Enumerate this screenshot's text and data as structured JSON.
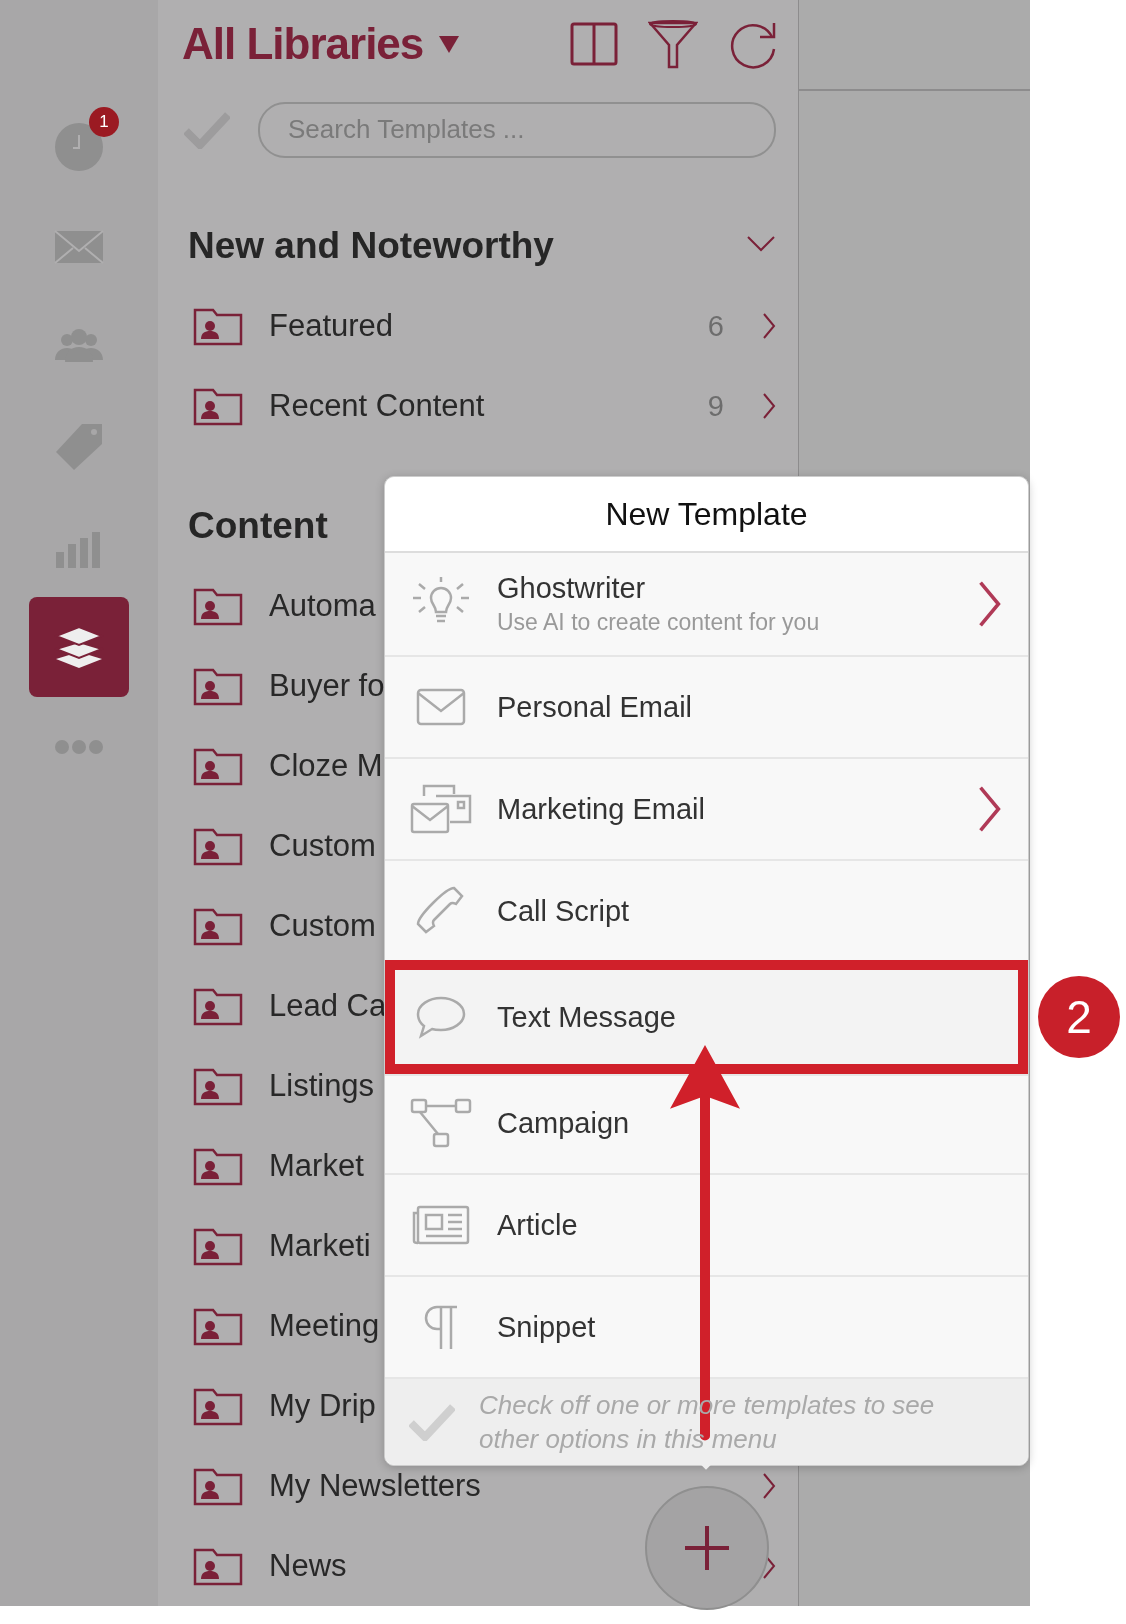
{
  "header": {
    "title": "All Libraries"
  },
  "rail": [
    {
      "kind": "clock",
      "badge": "1",
      "selected": false
    },
    {
      "kind": "mail",
      "selected": false
    },
    {
      "kind": "people",
      "selected": false
    },
    {
      "kind": "tag",
      "selected": false
    },
    {
      "kind": "chart",
      "selected": false
    },
    {
      "kind": "layers",
      "selected": true
    },
    {
      "kind": "more",
      "selected": false
    }
  ],
  "search": {
    "placeholder": "Search Templates ..."
  },
  "sections": [
    {
      "title": "New and Noteworthy",
      "expanded": true,
      "items": [
        {
          "label": "Featured",
          "count": "6",
          "chevron": true
        },
        {
          "label": "Recent Content",
          "count": "9",
          "chevron": true
        }
      ]
    },
    {
      "title": "Content",
      "items": [
        {
          "label": "Automa",
          "chevron": false
        },
        {
          "label": "Buyer fo",
          "chevron": false
        },
        {
          "label": "Cloze M",
          "chevron": false
        },
        {
          "label": "Custom",
          "chevron": false
        },
        {
          "label": "Custom",
          "chevron": false
        },
        {
          "label": "Lead Ca",
          "chevron": false
        },
        {
          "label": "Listings",
          "chevron": false
        },
        {
          "label": "Market",
          "chevron": false
        },
        {
          "label": "Marketi",
          "chevron": false
        },
        {
          "label": "Meeting",
          "chevron": false
        },
        {
          "label": "My Drip",
          "chevron": false
        },
        {
          "label": "My Newsletters",
          "chevron": true
        },
        {
          "label": "News",
          "chevron": true
        }
      ]
    }
  ],
  "menu": {
    "title": "New Template",
    "items": [
      {
        "kind": "bulb",
        "label": "Ghostwriter",
        "subtitle": "Use AI to create content for you",
        "submenu": true,
        "selected": false
      },
      {
        "kind": "envelope",
        "label": "Personal Email",
        "submenu": false,
        "selected": false
      },
      {
        "kind": "envelopes",
        "label": "Marketing Email",
        "submenu": true,
        "selected": false
      },
      {
        "kind": "phone",
        "label": "Call Script",
        "submenu": false,
        "selected": false
      },
      {
        "kind": "bubble",
        "label": "Text Message",
        "submenu": false,
        "selected": true
      },
      {
        "kind": "flow",
        "label": "Campaign",
        "submenu": false,
        "selected": false
      },
      {
        "kind": "news",
        "label": "Article",
        "submenu": false,
        "selected": false
      },
      {
        "kind": "pilcrow",
        "label": "Snippet",
        "submenu": false,
        "selected": false
      }
    ],
    "footer": "Check off one or more templates to see other options in this menu"
  },
  "annotation": {
    "step": "2"
  }
}
